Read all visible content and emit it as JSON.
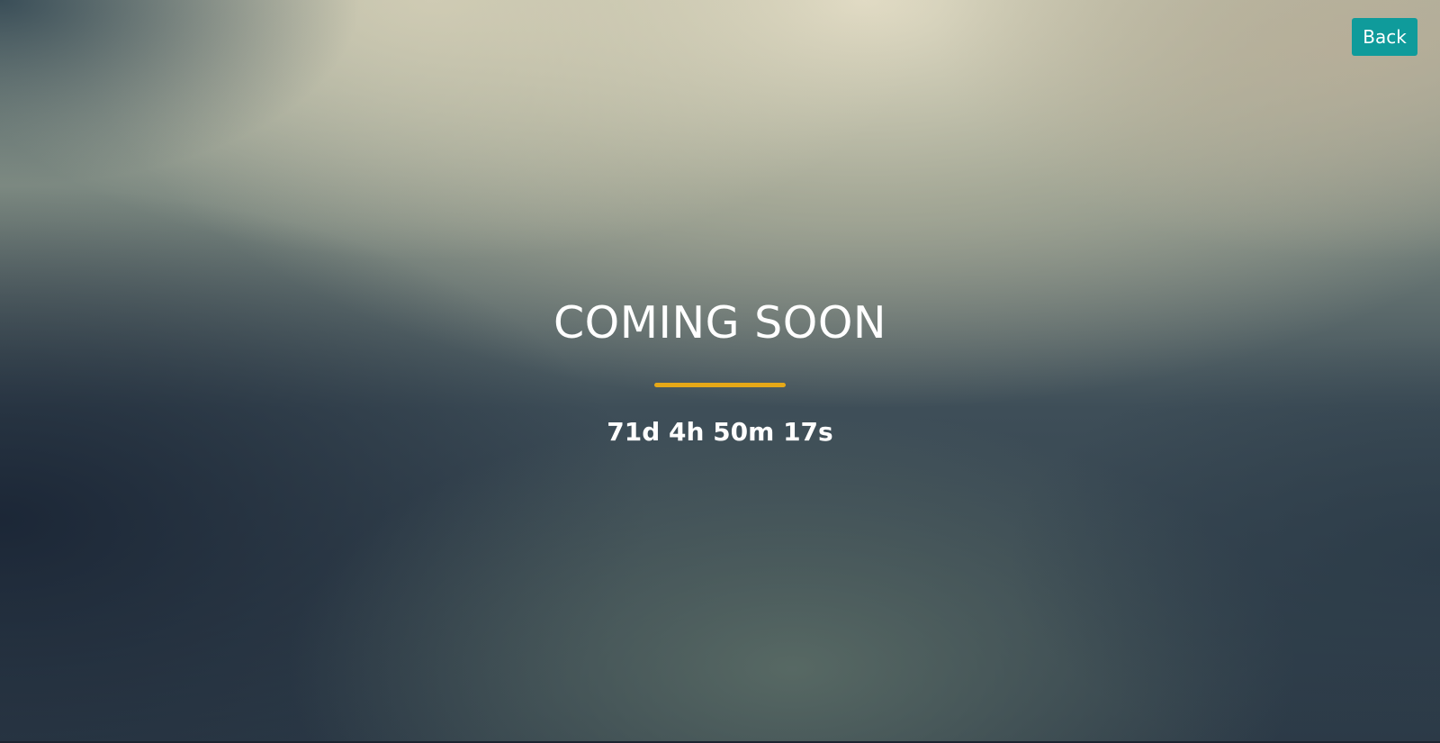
{
  "header": {
    "back_label": "Back"
  },
  "main": {
    "title": "COMING SOON",
    "countdown": "71d 4h 50m 17s"
  },
  "colors": {
    "back_button": "#0f9b9b",
    "divider_accent": "#e6a817",
    "text": "#ffffff"
  }
}
